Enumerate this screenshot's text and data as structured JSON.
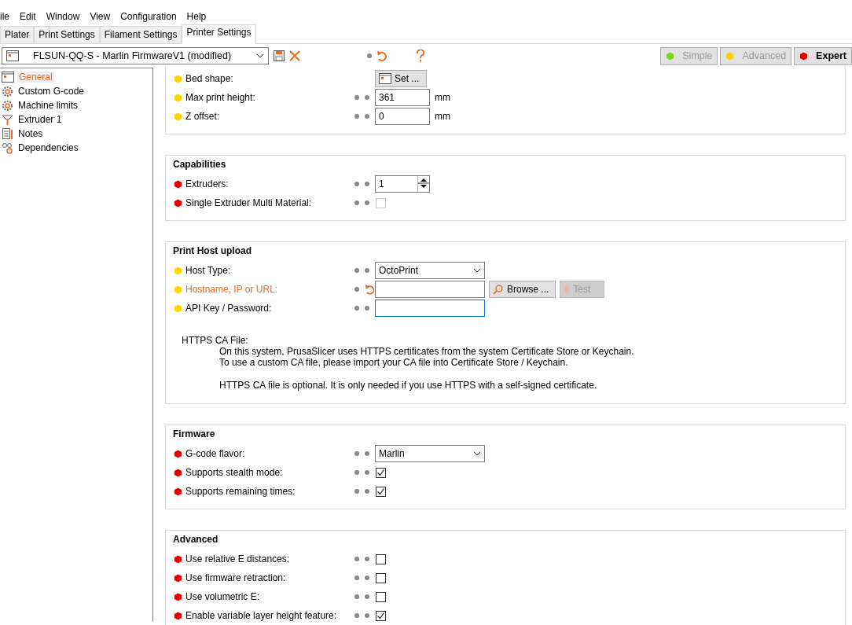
{
  "menu": [
    {
      "label": "ile"
    },
    {
      "label": "Edit"
    },
    {
      "label": "Window"
    },
    {
      "label": "View"
    },
    {
      "label": "Configuration"
    },
    {
      "label": "Help"
    }
  ],
  "tabs": [
    {
      "label": "Plater",
      "selected": false
    },
    {
      "label": "Print Settings",
      "selected": false
    },
    {
      "label": "Filament Settings",
      "selected": false
    },
    {
      "label": "Printer Settings",
      "selected": true
    }
  ],
  "preset": {
    "name": "FLSUN-QQ-S - Marlin FirmwareV1 (modified)"
  },
  "modes": [
    {
      "label": "Simple",
      "color": "#7ed321",
      "selected": false
    },
    {
      "label": "Advanced",
      "color": "#ffd200",
      "selected": false
    },
    {
      "label": "Expert",
      "color": "#e00000",
      "selected": true
    }
  ],
  "sidebar": {
    "items": [
      {
        "label": "General",
        "kind": "page",
        "selected": true
      },
      {
        "label": "Custom G-code",
        "kind": "gear",
        "selected": false
      },
      {
        "label": "Machine limits",
        "kind": "gear",
        "selected": false
      },
      {
        "label": "Extruder 1",
        "kind": "extruder",
        "selected": false
      },
      {
        "label": "Notes",
        "kind": "notes",
        "selected": false
      },
      {
        "label": "Dependencies",
        "kind": "deps",
        "selected": false
      }
    ]
  },
  "groups": [
    {
      "options": [
        {
          "label": "Bed shape:",
          "color": "#ffd200",
          "kind": "button",
          "value": "Set ..."
        },
        {
          "label": "Max print height:",
          "color": "#ffd200",
          "kind": "number",
          "value": "361",
          "unit": "mm"
        },
        {
          "label": "Z offset:",
          "color": "#ffd200",
          "kind": "number",
          "value": "0",
          "unit": "mm"
        }
      ]
    },
    {
      "title": "Capabilities",
      "options": [
        {
          "label": "Extruders:",
          "color": "#e00000",
          "kind": "spin",
          "value": "1"
        },
        {
          "label": "Single Extruder Multi Material:",
          "color": "#e00000",
          "kind": "checkbox",
          "checked": false,
          "disabled": true
        }
      ]
    },
    {
      "title": "Print Host upload",
      "options": [
        {
          "label": "Host Type:",
          "color": "#ffd200",
          "kind": "select",
          "value": "OctoPrint"
        },
        {
          "label": "Hostname, IP or URL:",
          "color": "#ffd200",
          "kind": "text",
          "modified": true,
          "buttons": [
            {
              "label": "Browse ...",
              "disabled": false
            },
            {
              "label": "Test",
              "disabled": true
            }
          ]
        },
        {
          "label": "API Key / Password:",
          "color": "#ffd200",
          "kind": "text",
          "focused": true
        }
      ],
      "note": {
        "heading": "HTTPS CA File:",
        "lines": [
          "On this system, PrusaSlicer uses HTTPS certificates from the system Certificate Store or Keychain.",
          "To use a custom CA file, please import your CA file into Certificate Store / Keychain.",
          "HTTPS CA file is optional. It is only needed if you use HTTPS with a self-signed certificate."
        ]
      }
    },
    {
      "title": "Firmware",
      "options": [
        {
          "label": "G-code flavor:",
          "color": "#e00000",
          "kind": "select",
          "value": "Marlin"
        },
        {
          "label": "Supports stealth mode:",
          "color": "#e00000",
          "kind": "checkbox",
          "checked": true
        },
        {
          "label": "Supports remaining times:",
          "color": "#e00000",
          "kind": "checkbox",
          "checked": true
        }
      ]
    },
    {
      "title": "Advanced",
      "options": [
        {
          "label": "Use relative E distances:",
          "color": "#e00000",
          "kind": "checkbox",
          "checked": false
        },
        {
          "label": "Use firmware retraction:",
          "color": "#e00000",
          "kind": "checkbox",
          "checked": false
        },
        {
          "label": "Use volumetric E:",
          "color": "#e00000",
          "kind": "checkbox",
          "checked": false
        },
        {
          "label": "Enable variable layer height feature:",
          "color": "#e00000",
          "kind": "checkbox",
          "checked": true
        }
      ]
    }
  ]
}
